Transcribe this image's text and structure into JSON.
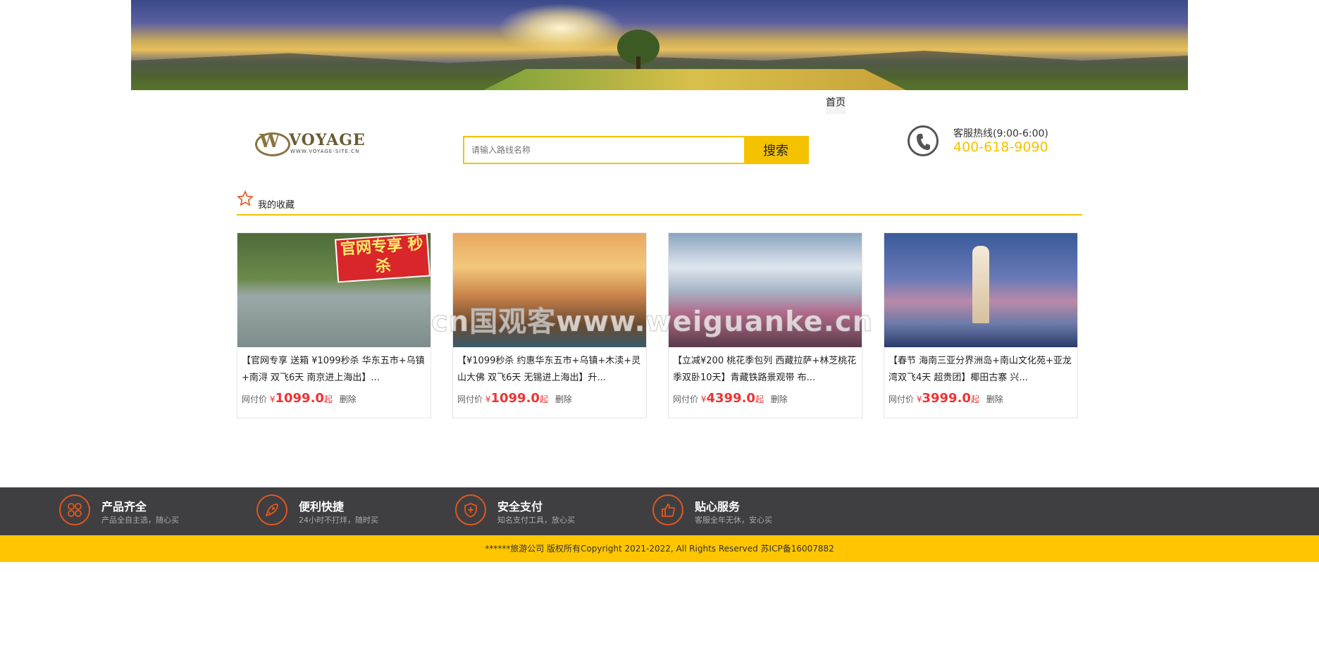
{
  "header": {
    "nav_home": "首页"
  },
  "logo": {
    "name": "VOYAGE",
    "site": "WWW.VOYAGE-SITE.CN"
  },
  "search": {
    "placeholder": "请输入路线名称",
    "button_label": "搜索"
  },
  "hotline": {
    "label": "客服热线(9:00-6:00)",
    "number": "400-618-9090"
  },
  "favorites": {
    "title": "我的收藏",
    "price_prefix": "网付价",
    "currency": "¥",
    "price_suffix": "起",
    "delete_label": "删除",
    "items": [
      {
        "desc": "【官网专享 送箱 ¥1099秒杀 华东五市+乌镇+南浔 双飞6天 南京进上海出】...",
        "price": "1099.0",
        "badge": "官网专享 秒杀"
      },
      {
        "desc": "【¥1099秒杀 约惠华东五市+乌镇+木渎+灵山大佛 双飞6天 无锡进上海出】升...",
        "price": "1099.0"
      },
      {
        "desc": "【立减¥200 桃花季包列 西藏拉萨+林芝桃花季双卧10天】青藏铁路景观带 布...",
        "price": "4399.0"
      },
      {
        "desc": "【春节 海南三亚分界洲岛+南山文化苑+亚龙湾双飞4天 超贵团】椰田古寨 兴...",
        "price": "3999.0"
      }
    ]
  },
  "watermark": "cn国观客www.weiguanke.cn",
  "features": [
    {
      "title": "产品齐全",
      "subtitle": "产品全自主选，随心买",
      "icon": "grid-icon"
    },
    {
      "title": "便利快捷",
      "subtitle": "24小时不打烊，随时买",
      "icon": "rocket-icon"
    },
    {
      "title": "安全支付",
      "subtitle": "知名支付工具，放心买",
      "icon": "shield-icon"
    },
    {
      "title": "贴心服务",
      "subtitle": "客服全年无休，安心买",
      "icon": "thumbs-up-icon"
    }
  ],
  "footer": {
    "copyright": "******旅游公司 版权所有Copyright 2021-2022, All Rights Reserved 苏ICP备16007882"
  },
  "colors": {
    "accent": "#f5c200",
    "price": "#e33333",
    "feature_bar": "#3f3f41",
    "feature_icon": "#e2561f"
  }
}
